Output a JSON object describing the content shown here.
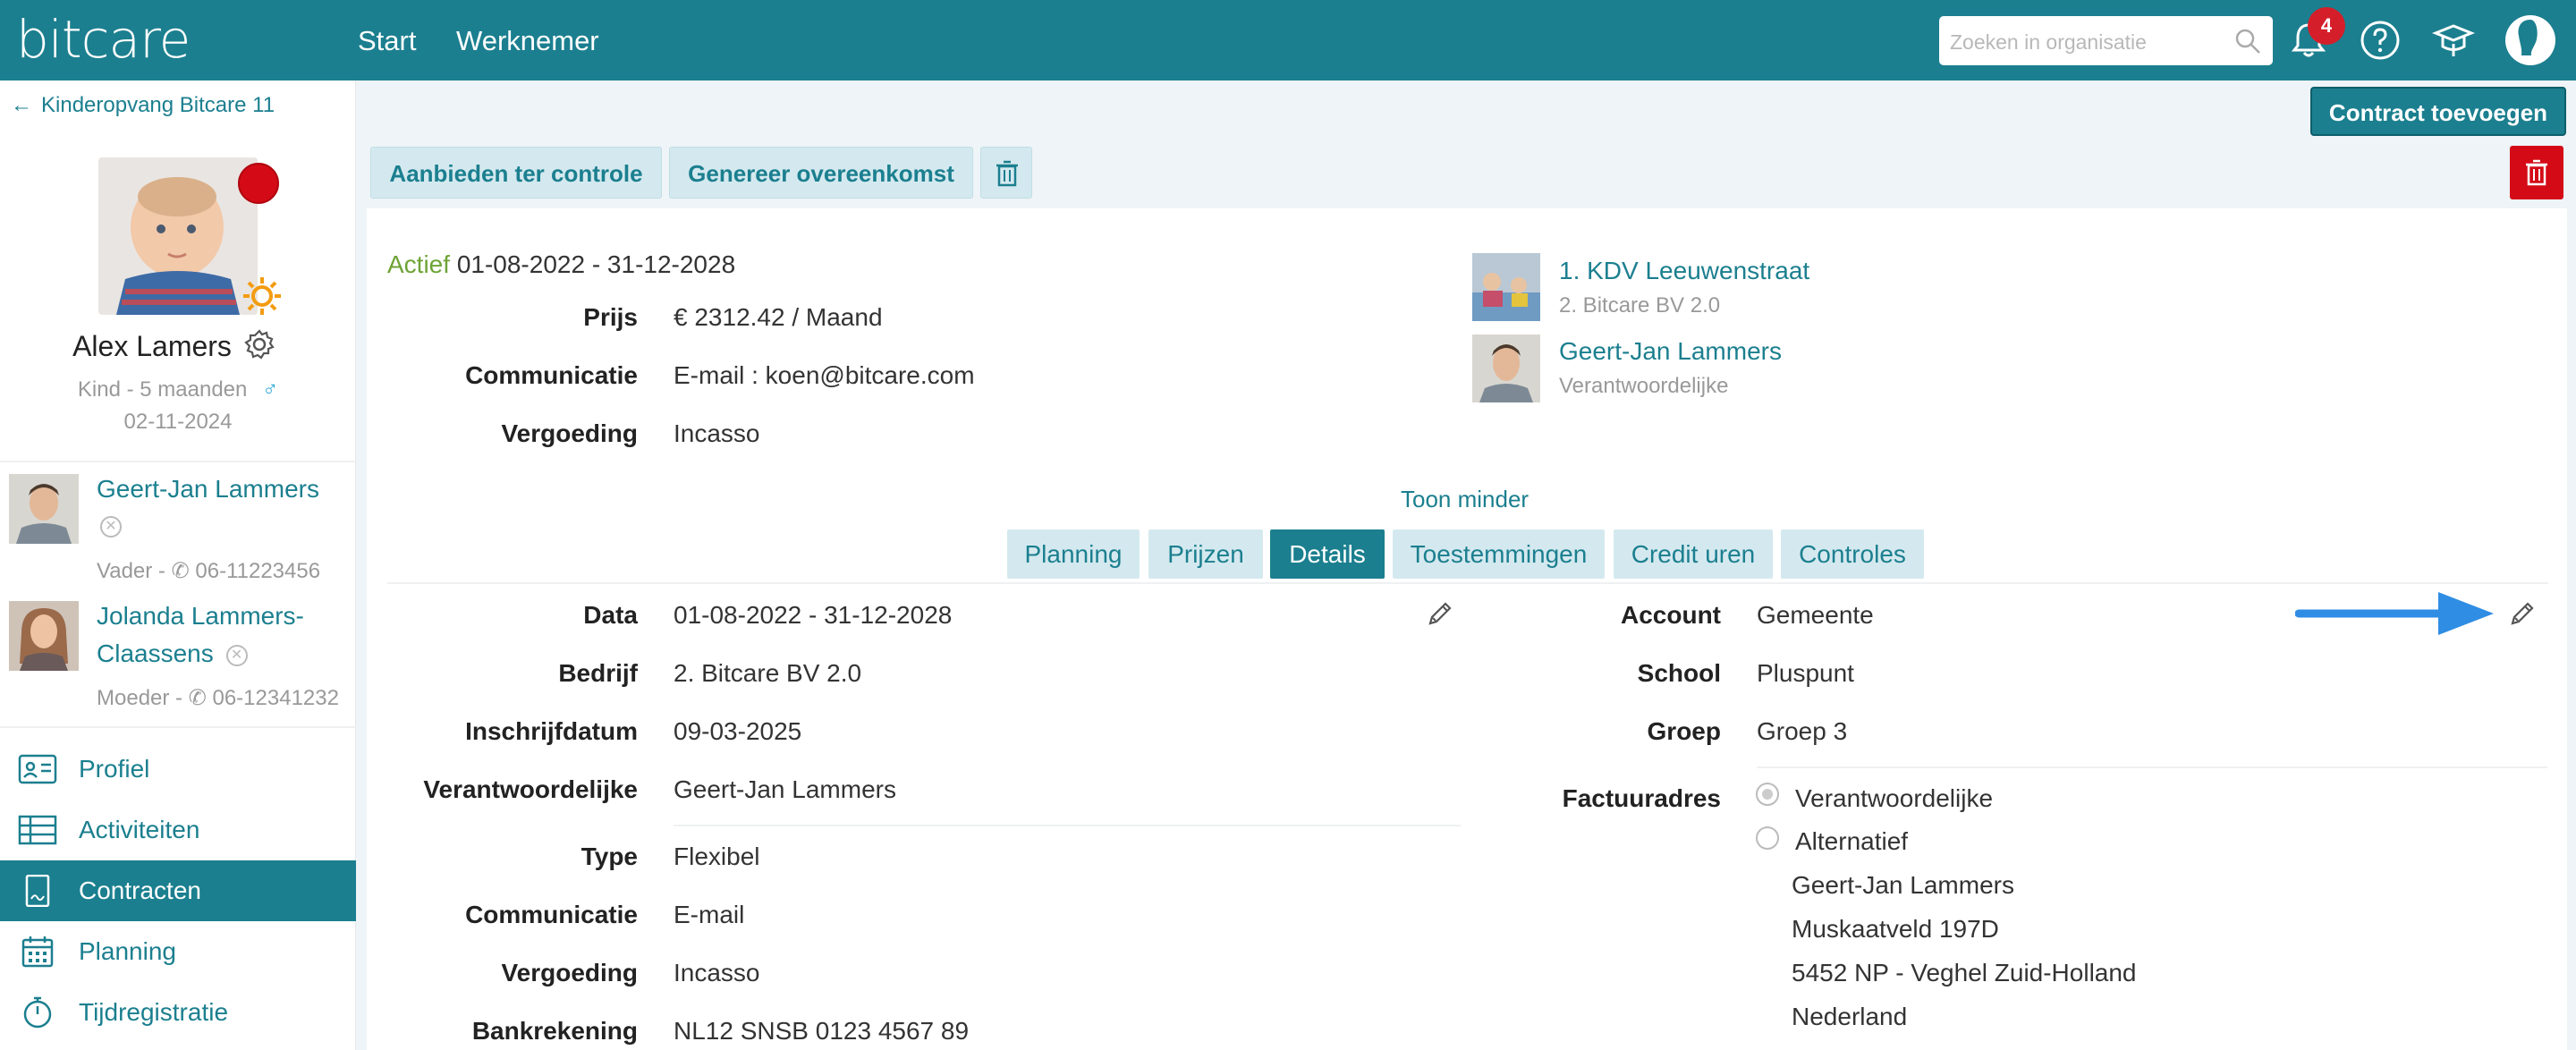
{
  "header": {
    "logo": "bitcare",
    "nav": [
      "Start",
      "Werknemer"
    ],
    "search_placeholder": "Zoeken in organisatie",
    "notifications_count": "4"
  },
  "sidebar": {
    "back_label": "Kinderopvang Bitcare 11",
    "child": {
      "name": "Alex Lamers",
      "meta": "Kind - 5 maanden",
      "date": "02-11-2024"
    },
    "parents": [
      {
        "name": "Geert-Jan Lammers",
        "meta": "Vader - ",
        "phone": "06-11223456"
      },
      {
        "name_line1": "Jolanda Lammers-",
        "name_line2": "Claassens",
        "meta": "Moeder - ",
        "phone": "06-12341232"
      }
    ],
    "menu": [
      "Profiel",
      "Activiteiten",
      "Contracten",
      "Planning",
      "Tijdregistratie"
    ]
  },
  "actions": {
    "add_contract": "Contract toevoegen",
    "offer_review": "Aanbieden ter controle",
    "generate_agreement": "Genereer overeenkomst"
  },
  "contract": {
    "status": "Actief",
    "period": "01-08-2022 - 31-12-2028",
    "summary": [
      {
        "label": "Prijs",
        "value": "€ 2312.42 / Maand"
      },
      {
        "label": "Communicatie",
        "value": "E-mail : koen@bitcare.com"
      },
      {
        "label": "Vergoeding",
        "value": "Incasso"
      }
    ],
    "location": {
      "name": "1. KDV Leeuwenstraat",
      "sub": "2. Bitcare BV 2.0"
    },
    "responsible": {
      "name": "Geert-Jan Lammers",
      "sub": "Verantwoordelijke"
    },
    "toggle_label": "Toon minder"
  },
  "tabs": [
    "Planning",
    "Prijzen",
    "Details",
    "Toestemmingen",
    "Credit uren",
    "Controles"
  ],
  "details_left": [
    {
      "label": "Data",
      "value": "01-08-2022 - 31-12-2028"
    },
    {
      "label": "Bedrijf",
      "value": "2. Bitcare BV 2.0"
    },
    {
      "label": "Inschrijfdatum",
      "value": "09-03-2025"
    },
    {
      "label": "Verantwoordelijke",
      "value": "Geert-Jan Lammers"
    },
    {
      "label": "Type",
      "value": "Flexibel"
    },
    {
      "label": "Communicatie",
      "value": "E-mail"
    },
    {
      "label": "Vergoeding",
      "value": "Incasso"
    },
    {
      "label": "Bankrekening",
      "value": "NL12 SNSB 0123 4567 89"
    }
  ],
  "details_right": [
    {
      "label": "Account",
      "value": "Gemeente"
    },
    {
      "label": "School",
      "value": "Pluspunt"
    },
    {
      "label": "Groep",
      "value": "Groep 3"
    }
  ],
  "billing": {
    "label": "Factuuradres",
    "option_responsible": "Verantwoordelijke",
    "option_alternative": "Alternatief",
    "address": [
      "Geert-Jan Lammers",
      "Muskaatveld 197D",
      "5452 NP - Veghel Zuid-Holland",
      "Nederland"
    ]
  },
  "colors": {
    "brand": "#1b7f8f",
    "active": "#6ea336",
    "danger": "#d40b17",
    "arrow": "#2f8de4"
  }
}
